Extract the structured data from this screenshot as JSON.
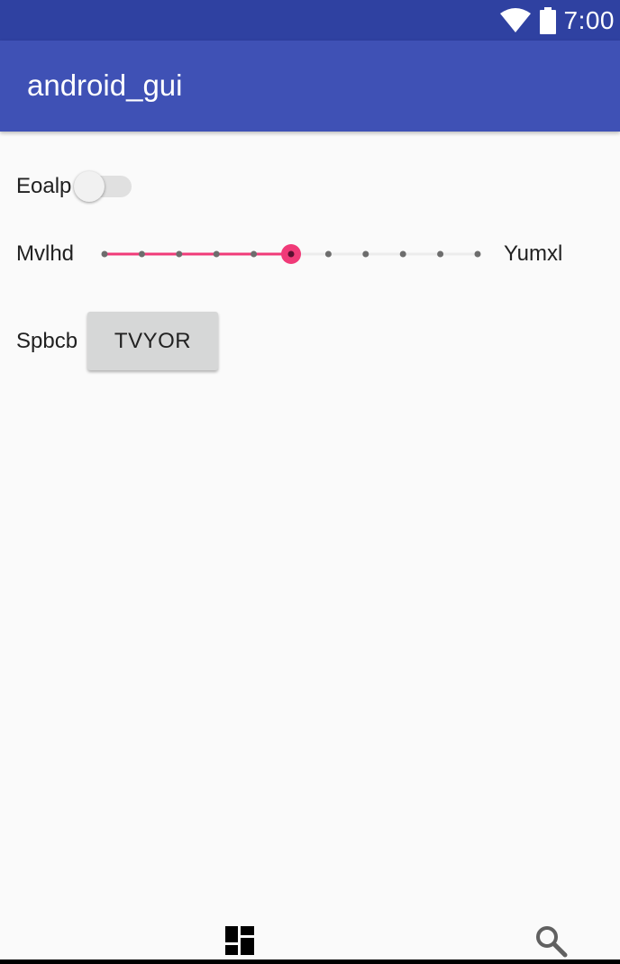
{
  "status_bar": {
    "time": "7:00",
    "icons": [
      "wifi-icon",
      "battery-icon"
    ],
    "color": "#2f41a1"
  },
  "app_bar": {
    "title": "android_gui",
    "color": "#3f51b5"
  },
  "switch_row": {
    "label": "Eoalp",
    "checked": false
  },
  "slider_row": {
    "start_label": "Mvlhd",
    "end_label": "Yumxl",
    "steps": 10,
    "value": 5,
    "accent": "#f03a78"
  },
  "button_row": {
    "label": "Spbcb",
    "button_text": "TVYOR"
  },
  "bottom_nav": {
    "icons": [
      "dashboard-icon",
      "search-icon"
    ]
  }
}
